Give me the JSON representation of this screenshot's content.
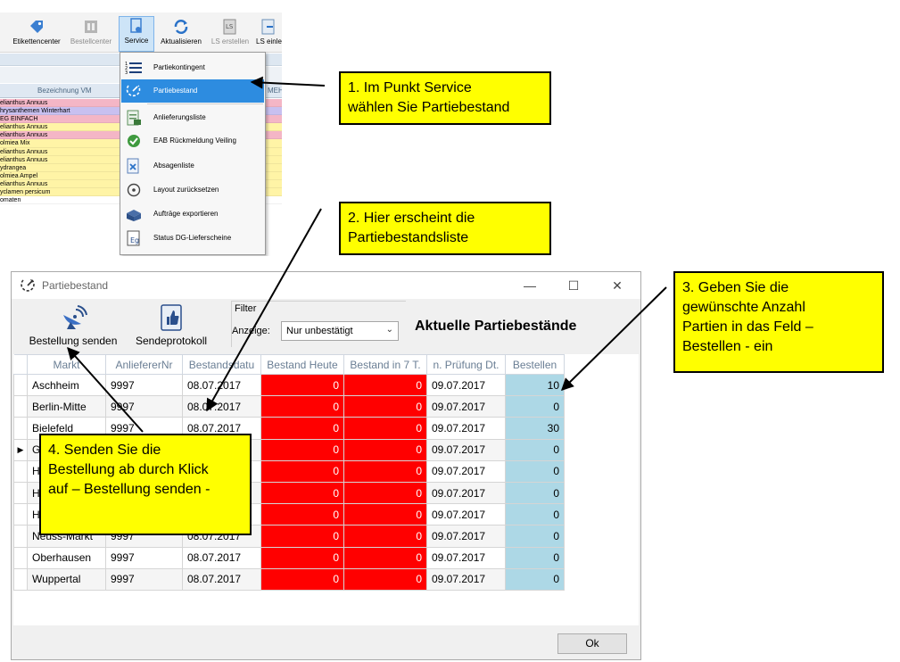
{
  "top_toolbar": {
    "buttons": [
      {
        "label": "Etikettencenter",
        "icon": "label-tag-icon"
      },
      {
        "label": "Bestellcenter",
        "icon": "order-center-icon"
      },
      {
        "label": "Service",
        "icon": "service-icon"
      },
      {
        "label": "Aktualisieren",
        "icon": "refresh-icon"
      },
      {
        "label": "LS erstellen",
        "icon": "ls-create-icon"
      },
      {
        "label": "LS einle",
        "icon": "ls-import-icon"
      }
    ],
    "column_header_left": "Bezeichnung VM",
    "column_header_right": "MEH"
  },
  "vm_rows": [
    {
      "text": "elianthus Annuus",
      "color": "#f4b6c6"
    },
    {
      "text": "hrysanthemen Winterhart",
      "color": "#c8c0f0"
    },
    {
      "text": "EG EINFACH",
      "color": "#f4b6c6"
    },
    {
      "text": "elianthus Annuus",
      "color": "#fff4a6"
    },
    {
      "text": "elianthus Annuus",
      "color": "#f4b6c6"
    },
    {
      "text": "olmiea Mix",
      "color": "#fff4a6"
    },
    {
      "text": "elianthus Annuus",
      "color": "#fff4a6"
    },
    {
      "text": "elianthus Annuus",
      "color": "#fff4a6"
    },
    {
      "text": "ydrangea",
      "color": "#fff4a6"
    },
    {
      "text": "olmiea Ampel",
      "color": "#fff4a6"
    },
    {
      "text": "elianthus Annuus",
      "color": "#fff4a6"
    },
    {
      "text": "yclamen persicum",
      "color": "#fff4a6"
    },
    {
      "text": "omaten",
      "color": "#ffffff"
    }
  ],
  "service_menu": {
    "items": [
      {
        "label": "Partiekontingent",
        "icon": "numbered-list-icon",
        "highlighted": false
      },
      {
        "label": "Partiebestand",
        "icon": "partie-stock-icon",
        "highlighted": true
      },
      {
        "label": "Anlieferungsliste",
        "icon": "delivery-list-icon",
        "highlighted": false
      },
      {
        "label": "EAB Rückmeldung Veiling",
        "icon": "auction-feedback-icon",
        "highlighted": false
      },
      {
        "label": "Absagenliste",
        "icon": "cancellation-list-icon",
        "highlighted": false
      },
      {
        "label": "Layout zurücksetzen",
        "icon": "reset-layout-icon",
        "highlighted": false
      },
      {
        "label": "Aufträge exportieren",
        "icon": "export-orders-icon",
        "highlighted": false
      },
      {
        "label": "Status DG-Lieferscheine",
        "icon": "delivery-note-status-icon",
        "highlighted": false
      }
    ]
  },
  "callouts": {
    "c1": "1. Im Punkt Service\nwählen Sie Partiebestand",
    "c2": "2. Hier erscheint die\nPartiebestandsliste",
    "c3": "3. Geben Sie die\ngewünschte Anzahl\nPartien in das Feld –\nBestellen - ein",
    "c4": "4. Senden Sie die\nBestellung ab durch Klick\nauf – Bestellung senden -"
  },
  "dialog": {
    "title": "Partiebestand",
    "toolbar": {
      "send_label": "Bestellung senden",
      "protocol_label": "Sendeprotokoll"
    },
    "filter": {
      "legend": "Filter",
      "label": "Anzeige:",
      "value": "Nur unbestätigt"
    },
    "list_title": "Aktuelle Partiebestände",
    "columns": [
      "Markt",
      "AnliefererNr",
      "Bestandsdatu",
      "Bestand Heute",
      "Bestand in 7 T.",
      "n. Prüfung Dt.",
      "Bestellen"
    ],
    "rows": [
      {
        "markt": "Aschheim",
        "nr": "9997",
        "datum": "08.07.2017",
        "heute": "0",
        "sieben": "0",
        "pruefung": "09.07.2017",
        "bestellen": "10"
      },
      {
        "markt": "Berlin-Mitte",
        "nr": "9997",
        "datum": "08.07.2017",
        "heute": "0",
        "sieben": "0",
        "pruefung": "09.07.2017",
        "bestellen": "0"
      },
      {
        "markt": "Bielefeld",
        "nr": "9997",
        "datum": "08.07.2017",
        "heute": "0",
        "sieben": "0",
        "pruefung": "09.07.2017",
        "bestellen": "30"
      },
      {
        "markt": "G",
        "nr": "",
        "datum": "",
        "heute": "0",
        "sieben": "0",
        "pruefung": "09.07.2017",
        "bestellen": "0"
      },
      {
        "markt": "H",
        "nr": "",
        "datum": "",
        "heute": "0",
        "sieben": "0",
        "pruefung": "09.07.2017",
        "bestellen": "0"
      },
      {
        "markt": "H",
        "nr": "",
        "datum": "",
        "heute": "0",
        "sieben": "0",
        "pruefung": "09.07.2017",
        "bestellen": "0"
      },
      {
        "markt": "H",
        "nr": "",
        "datum": "",
        "heute": "0",
        "sieben": "0",
        "pruefung": "09.07.2017",
        "bestellen": "0"
      },
      {
        "markt": "Neuss-Markt",
        "nr": "9997",
        "datum": "08.07.2017",
        "heute": "0",
        "sieben": "0",
        "pruefung": "09.07.2017",
        "bestellen": "0"
      },
      {
        "markt": "Oberhausen",
        "nr": "9997",
        "datum": "08.07.2017",
        "heute": "0",
        "sieben": "0",
        "pruefung": "09.07.2017",
        "bestellen": "0"
      },
      {
        "markt": "Wuppertal",
        "nr": "9997",
        "datum": "08.07.2017",
        "heute": "0",
        "sieben": "0",
        "pruefung": "09.07.2017",
        "bestellen": "0"
      }
    ],
    "ok_label": "Ok"
  }
}
